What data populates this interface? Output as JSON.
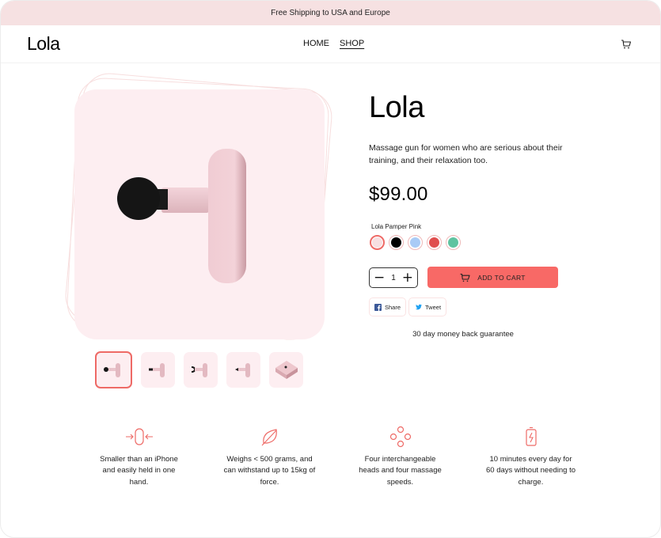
{
  "announcement": "Free Shipping to USA and Europe",
  "header": {
    "logo": "Lola",
    "nav": [
      {
        "label": "HOME",
        "active": false
      },
      {
        "label": "SHOP",
        "active": true
      }
    ],
    "cart_icon": "cart-icon"
  },
  "gallery": {
    "main_image": "massage-gun-pink-round-head",
    "thumbnails": [
      {
        "name": "round-head",
        "active": true
      },
      {
        "name": "flat-head",
        "active": false
      },
      {
        "name": "fork-head",
        "active": false
      },
      {
        "name": "bullet-head",
        "active": false
      },
      {
        "name": "packaging-box",
        "active": false
      }
    ]
  },
  "product": {
    "title": "Lola",
    "description": "Massage gun for women who are serious about their training, and their relaxation too.",
    "price": "$99.00",
    "selected_variant": "Lola Pamper Pink",
    "swatches": [
      {
        "name": "Lola Pamper Pink",
        "color": "#f7dfe1",
        "active": true
      },
      {
        "name": "Black",
        "color": "#000000",
        "active": false
      },
      {
        "name": "Blue",
        "color": "#a9cbf6",
        "active": false
      },
      {
        "name": "Red",
        "color": "#e04e4e",
        "active": false
      },
      {
        "name": "Green",
        "color": "#5fc3a0",
        "active": false
      }
    ],
    "quantity": "1",
    "decrement_label": "−",
    "increment_label": "+",
    "add_to_cart_label": "ADD TO CART",
    "share_label": "Share",
    "tweet_label": "Tweet",
    "guarantee": "30 day money back guarantee"
  },
  "features": [
    {
      "icon": "compact-size-icon",
      "text": "Smaller than an iPhone and easily held in one hand."
    },
    {
      "icon": "leaf-icon",
      "text": "Weighs < 500 grams, and can withstand up to 15kg of force."
    },
    {
      "icon": "heads-icon",
      "text": "Four interchangeable heads and four massage speeds."
    },
    {
      "icon": "battery-icon",
      "text": "10 minutes every day for 60 days without needing to charge."
    }
  ],
  "colors": {
    "accent": "#f86966",
    "announcement_bg": "#f6e1e2",
    "product_bg": "#fdeef1",
    "icon_stroke": "#ee6a66"
  }
}
